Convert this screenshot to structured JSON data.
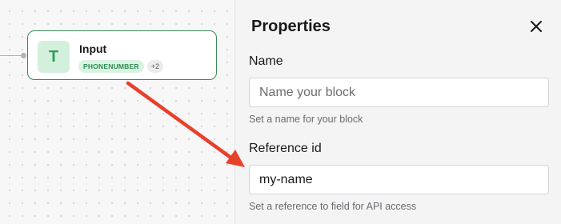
{
  "canvas": {
    "node": {
      "icon_letter": "T",
      "title": "Input",
      "tags": [
        "PHONENUMBER"
      ],
      "more_count": "+2"
    }
  },
  "properties": {
    "title": "Properties",
    "close_icon": "close-icon",
    "fields": [
      {
        "label": "Name",
        "value": "",
        "placeholder": "Name your block",
        "help": "Set a name for your block"
      },
      {
        "label": "Reference id",
        "value": "my-name",
        "placeholder": "",
        "help": "Set a reference to field for API access"
      }
    ]
  },
  "colors": {
    "node_border": "#3a8a55",
    "node_icon_bg": "#d3f0dd",
    "tag_text": "#2f8a52",
    "arrow": "#e8402a"
  }
}
